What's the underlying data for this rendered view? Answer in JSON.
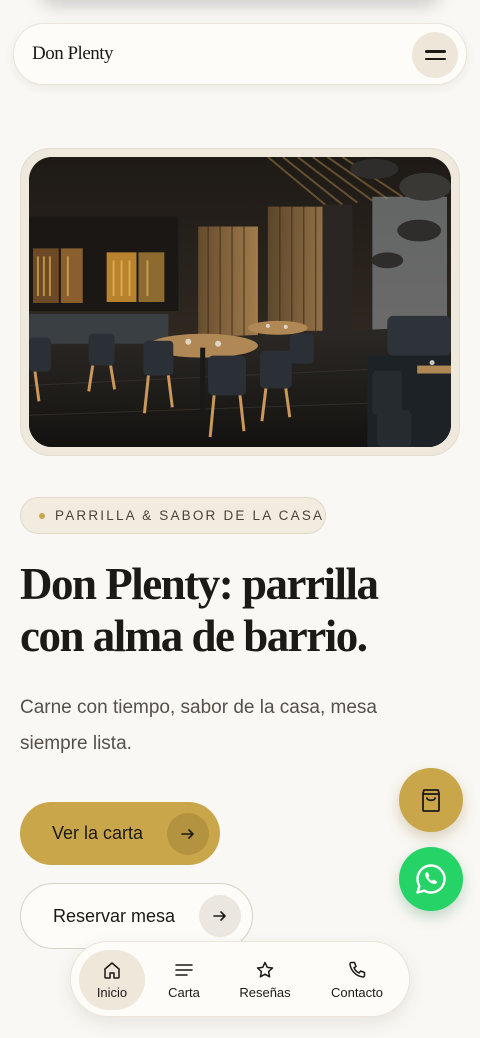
{
  "header": {
    "brand": "Don Plenty",
    "menu_icon": "hamburger-menu-icon"
  },
  "hero": {
    "image_description_icon": "restaurant-interior-photo"
  },
  "tag": {
    "label": "PARRILLA & SABOR DE LA CASA"
  },
  "title": {
    "line1": "Don Plenty: parrilla",
    "line2": "con alma de barrio."
  },
  "subtitle": "Carne con tiempo, sabor de la casa, mesa siempre lista.",
  "buttons": {
    "primary_label": "Ver la carta",
    "secondary_label": "Reservar mesa",
    "arrow_icon": "arrow-right-icon"
  },
  "fabs": {
    "cart_icon": "shopping-bag-icon",
    "whatsapp_icon": "whatsapp-icon"
  },
  "nav": {
    "items": [
      {
        "label": "Inicio",
        "icon": "home-icon"
      },
      {
        "label": "Carta",
        "icon": "menu-lines-icon"
      },
      {
        "label": "Reseñas",
        "icon": "star-icon"
      },
      {
        "label": "Contacto",
        "icon": "phone-icon"
      }
    ],
    "active_index": 0
  },
  "colors": {
    "accent": "#c9a64a",
    "background": "#faf8f4",
    "whatsapp": "#25d366",
    "text": "#1c1a17"
  }
}
